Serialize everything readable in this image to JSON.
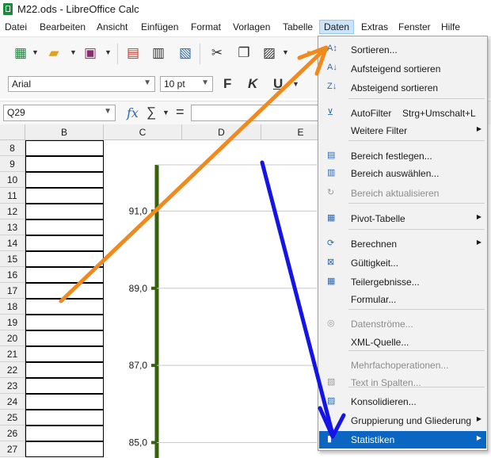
{
  "window": {
    "title": "M22.ods - LibreOffice Calc"
  },
  "menubar": [
    "Datei",
    "Bearbeiten",
    "Ansicht",
    "Einfügen",
    "Format",
    "Vorlagen",
    "Tabelle",
    "Daten",
    "Extras",
    "Fenster",
    "Hilfe"
  ],
  "toolbar": {
    "font_name": "Arial",
    "font_size": "10 pt",
    "bold_label": "F",
    "italic_label": "K",
    "underline_label": "U"
  },
  "formula_bar": {
    "cell_ref": "Q29",
    "function_icon": "fx",
    "sum_icon": "∑",
    "equals": "="
  },
  "columns": [
    "B",
    "C",
    "D",
    "E"
  ],
  "rows": [
    "8",
    "9",
    "10",
    "11",
    "12",
    "13",
    "14",
    "15",
    "16",
    "17",
    "18",
    "19",
    "20",
    "21",
    "22",
    "23",
    "24",
    "25",
    "26",
    "27"
  ],
  "chart_data": {
    "type": "bar",
    "ytick_labels": [
      "91,0",
      "89,0",
      "87,0",
      "85,0"
    ],
    "yticks": [
      91.0,
      89.0,
      87.0,
      85.0
    ],
    "ylim": [
      84.6,
      92.2
    ],
    "grid": true
  },
  "data_menu": {
    "items": [
      {
        "label": "Sortieren...",
        "icon": "sort-icon",
        "disabled": false,
        "submenu": false
      },
      {
        "label": "Aufsteigend sortieren",
        "icon": "sort-ascending-icon",
        "disabled": false,
        "submenu": false
      },
      {
        "label": "Absteigend sortieren",
        "icon": "sort-descending-icon",
        "disabled": false,
        "submenu": false
      },
      {
        "label": "AutoFilter",
        "shortcut": "Strg+Umschalt+L",
        "icon": "autofilter-icon",
        "disabled": false,
        "submenu": false
      },
      {
        "label": "Weitere Filter",
        "icon": "",
        "disabled": false,
        "submenu": true
      },
      {
        "label": "Bereich festlegen...",
        "icon": "define-range-icon",
        "disabled": false,
        "submenu": false
      },
      {
        "label": "Bereich auswählen...",
        "icon": "select-range-icon",
        "disabled": false,
        "submenu": false
      },
      {
        "label": "Bereich aktualisieren",
        "icon": "refresh-range-icon",
        "disabled": true,
        "submenu": false
      },
      {
        "label": "Pivot-Tabelle",
        "icon": "pivot-table-icon",
        "disabled": false,
        "submenu": true
      },
      {
        "label": "Berechnen",
        "icon": "calculate-icon",
        "disabled": false,
        "submenu": true
      },
      {
        "label": "Gültigkeit...",
        "icon": "validity-icon",
        "disabled": false,
        "submenu": false
      },
      {
        "label": "Teilergebnisse...",
        "icon": "subtotals-icon",
        "disabled": false,
        "submenu": false
      },
      {
        "label": "Formular...",
        "icon": "",
        "disabled": false,
        "submenu": false
      },
      {
        "label": "Datenströme...",
        "icon": "data-streams-icon",
        "disabled": true,
        "submenu": false
      },
      {
        "label": "XML-Quelle...",
        "icon": "",
        "disabled": false,
        "submenu": false
      },
      {
        "label": "Mehrfachoperationen...",
        "icon": "",
        "disabled": true,
        "submenu": false
      },
      {
        "label": "Text in Spalten...",
        "icon": "text-to-columns-icon",
        "disabled": true,
        "submenu": false
      },
      {
        "label": "Konsolidieren...",
        "icon": "consolidate-icon",
        "disabled": false,
        "submenu": false
      },
      {
        "label": "Gruppierung und Gliederung",
        "icon": "",
        "disabled": false,
        "submenu": true
      },
      {
        "label": "Statistiken",
        "icon": "statistics-icon",
        "disabled": false,
        "submenu": true,
        "highlighted": true
      }
    ]
  },
  "colors": {
    "accent": "#0a66c2",
    "menu_active": "#cce4f7",
    "chart_axis": "#38610b",
    "annotation_orange": "#f08a1c",
    "annotation_blue": "#1414e6"
  }
}
